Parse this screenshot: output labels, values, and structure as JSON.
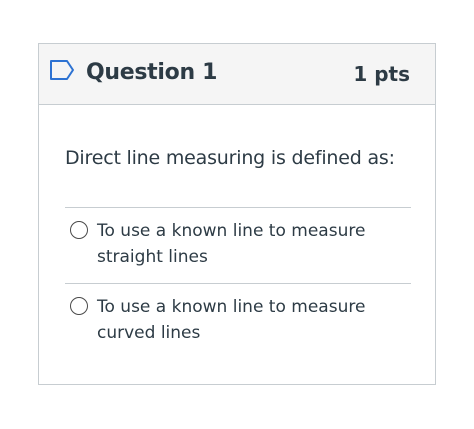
{
  "question": {
    "title": "Question 1",
    "points": "1 pts",
    "text": "Direct line measuring is defined as:",
    "answers": [
      {
        "label": "To use a known line to measure straight lines",
        "selected": false
      },
      {
        "label": "To use a known line to measure curved lines",
        "selected": false
      }
    ]
  },
  "colors": {
    "text": "#2d3b45",
    "border": "#c7cdd1",
    "header_bg": "#f5f5f5",
    "flag": "#2d72d2"
  },
  "icons": {
    "flag": "bookmark-flag-icon"
  }
}
